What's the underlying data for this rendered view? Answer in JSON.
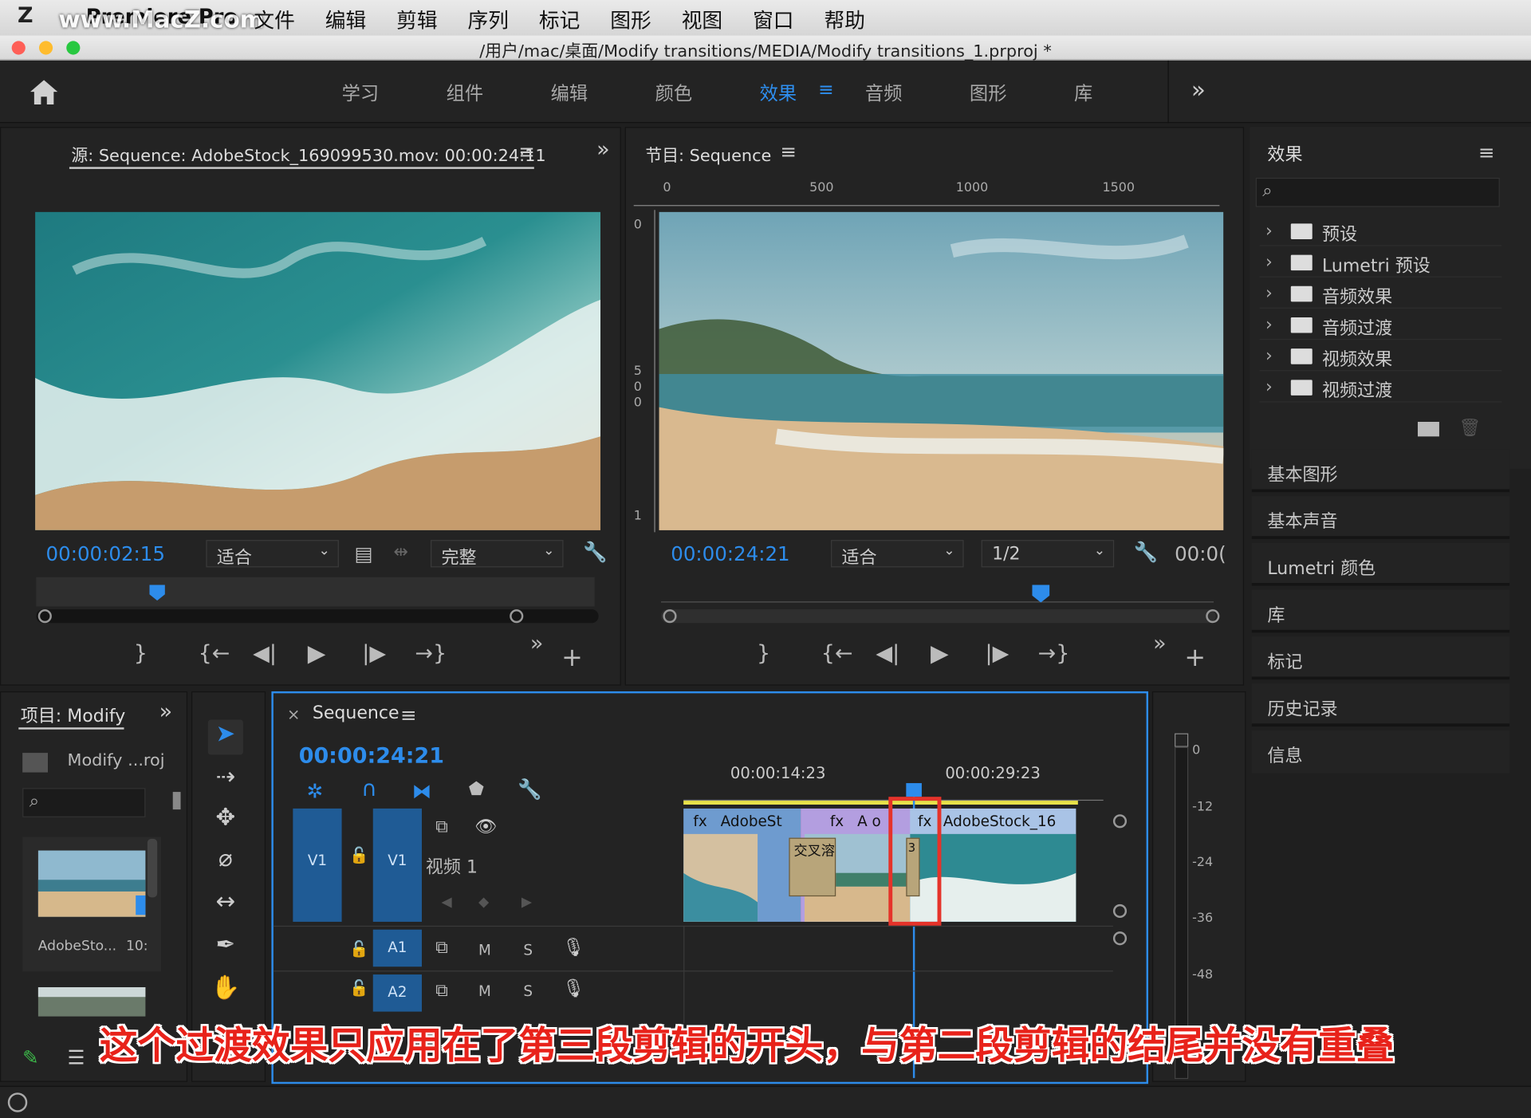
{
  "mac_menu": {
    "app": "Premiere Pro",
    "items": [
      "文件",
      "编辑",
      "剪辑",
      "序列",
      "标记",
      "图形",
      "视图",
      "窗口",
      "帮助"
    ],
    "watermark": "www.MacZ.com"
  },
  "window_title": "/用户/mac/桌面/Modify transitions/MEDIA/Modify transitions_1.prproj *",
  "workspaces": {
    "tabs": [
      "学习",
      "组件",
      "编辑",
      "颜色",
      "效果",
      "音频",
      "图形",
      "库"
    ],
    "active": "效果",
    "more": "»"
  },
  "source_monitor": {
    "title": "源: Sequence: AdobeStock_169099530.mov: 00:00:24:11",
    "timecode": "00:00:02:15",
    "fit": "适合",
    "quality": "完整"
  },
  "program_monitor": {
    "title": "节目: Sequence",
    "timecode": "00:00:24:21",
    "fit": "适合",
    "resolution": "1/2",
    "timecode_right": "00:0(",
    "ruler": [
      "0",
      "500",
      "1000",
      "1500"
    ],
    "vruler": [
      "0",
      "5",
      "0",
      "0",
      "1"
    ]
  },
  "effects_panel": {
    "title": "效果",
    "items": [
      "预设",
      "Lumetri 预设",
      "音频效果",
      "音频过渡",
      "视频效果",
      "视频过渡"
    ],
    "side_panels": [
      "基本图形",
      "基本声音",
      "Lumetri 颜色",
      "库",
      "标记",
      "历史记录",
      "信息"
    ]
  },
  "project_panel": {
    "title": "项目: Modify",
    "file": "Modify ...roj",
    "clip_name": "AdobeSto...",
    "clip_duration": "10:"
  },
  "timeline": {
    "title": "Sequence",
    "timecode": "00:00:24:21",
    "ruler": [
      "00:00:14:23",
      "00:00:29:23"
    ],
    "tracks": {
      "v1_src": "V1",
      "v1": "V1",
      "v1_name": "视频 1",
      "a1": "A1",
      "a2": "A2",
      "m": "M",
      "s": "S"
    },
    "clips": [
      {
        "label": "AdobeSt",
        "fx": "fx"
      },
      {
        "label": "A o",
        "fx": "fx"
      },
      {
        "label": "AdobeStock_16",
        "fx": "fx"
      }
    ],
    "transitions": [
      "交叉溶",
      "3"
    ]
  },
  "audio_meter": [
    "0",
    "-12",
    "-24",
    "-36",
    "-48"
  ],
  "caption": "这个过渡效果只应用在了第三段剪辑的开头，与第二段剪辑的结尾并没有重叠",
  "colors": {
    "accent": "#2d8ceb",
    "caption": "#e8221a",
    "highlight_box": "#e5332a"
  }
}
